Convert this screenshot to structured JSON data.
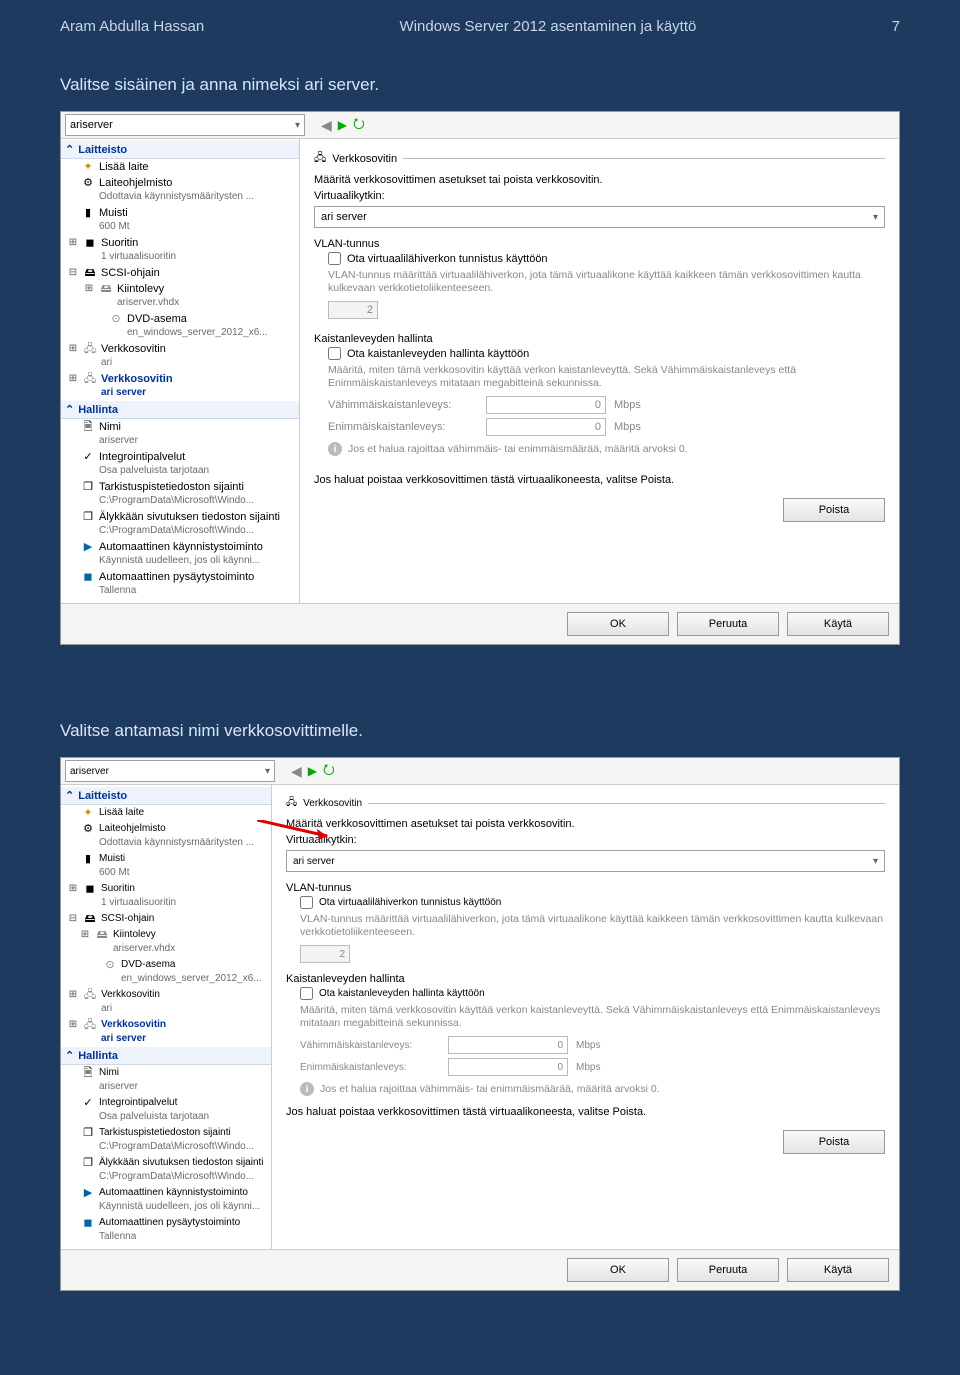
{
  "header": {
    "author": "Aram Abdulla Hassan",
    "title": "Windows Server 2012 asentaminen ja käyttö",
    "page": "7"
  },
  "captions": {
    "c1": "Valitse sisäinen ja anna nimeksi ari server.",
    "c2": "Valitse antamasi nimi verkkosovittimelle."
  },
  "toolbar": {
    "vm_name": "ariserver"
  },
  "tree": {
    "hw_header": "Laitteisto",
    "add_device": "Lisää laite",
    "firmware": "Laiteohjelmisto",
    "firmware_sub": "Odottavia käynnistysmääritysten ...",
    "memory": "Muisti",
    "memory_sub": "600 Mt",
    "cpu": "Suoritin",
    "cpu_sub": "1 virtuaalisuoritin",
    "scsi": "SCSI-ohjain",
    "hdd": "Kiintolevy",
    "hdd_sub": "ariserver.vhdx",
    "dvd": "DVD-asema",
    "dvd_sub": "en_windows_server_2012_x6...",
    "nic1": "Verkkosovitin",
    "nic1_sub": "ari",
    "nic2": "Verkkosovitin",
    "nic2_sub": "ari server",
    "mgmt_header": "Hallinta",
    "name": "Nimi",
    "name_sub": "ariserver",
    "integ": "Integrointipalvelut",
    "integ_sub": "Osa palveluista tarjotaan",
    "chkpt": "Tarkistuspistetiedoston sijainti",
    "chkpt_sub": "C:\\ProgramData\\Microsoft\\Windo...",
    "smart": "Älykkään sivutuksen tiedoston sijainti",
    "smart_sub": "C:\\ProgramData\\Microsoft\\Windo...",
    "autostart": "Automaattinen käynnistystoiminto",
    "autostart_sub": "Käynnistä uudelleen, jos oli käynni...",
    "autostop": "Automaattinen pysäytystoiminto",
    "autostop_sub": "Tallenna"
  },
  "content": {
    "panel_title": "Verkkosovitin",
    "desc": "Määritä verkkosovittimen asetukset tai poista verkkosovitin.",
    "vswitch_label": "Virtuaalikytkin:",
    "vswitch_value": "ari server",
    "vlan_title": "VLAN-tunnus",
    "vlan_check": "Ota virtuaalilähiverkon tunnistus käyttöön",
    "vlan_desc": "VLAN-tunnus määrittää virtuaalilähiverkon, jota tämä virtuaalikone käyttää kaikkeen tämän verkkosovittimen kautta kulkevaan verkkotietoliikenteeseen.",
    "vlan_id": "2",
    "bw_title": "Kaistanleveyden hallinta",
    "bw_check": "Ota kaistanleveyden hallinta käyttöön",
    "bw_desc": "Määritä, miten tämä verkkosovitin käyttää verkon kaistanleveyttä. Sekä Vähimmäiskaistanleveys että Enimmäiskaistanleveys mitataan megabitteinä sekunnissa.",
    "bw_min_label": "Vähimmäiskaistanleveys:",
    "bw_max_label": "Enimmäiskaistanleveys:",
    "bw_zero": "0",
    "bw_unit": "Mbps",
    "bw_info": "Jos et halua rajoittaa vähimmäis- tai enimmäismäärää, määritä arvoksi 0.",
    "remove_desc": "Jos haluat poistaa verkkosovittimen tästä virtuaalikoneesta, valitse Poista.",
    "btn_remove": "Poista"
  },
  "footer": {
    "ok": "OK",
    "cancel": "Peruuta",
    "apply": "Käytä"
  }
}
